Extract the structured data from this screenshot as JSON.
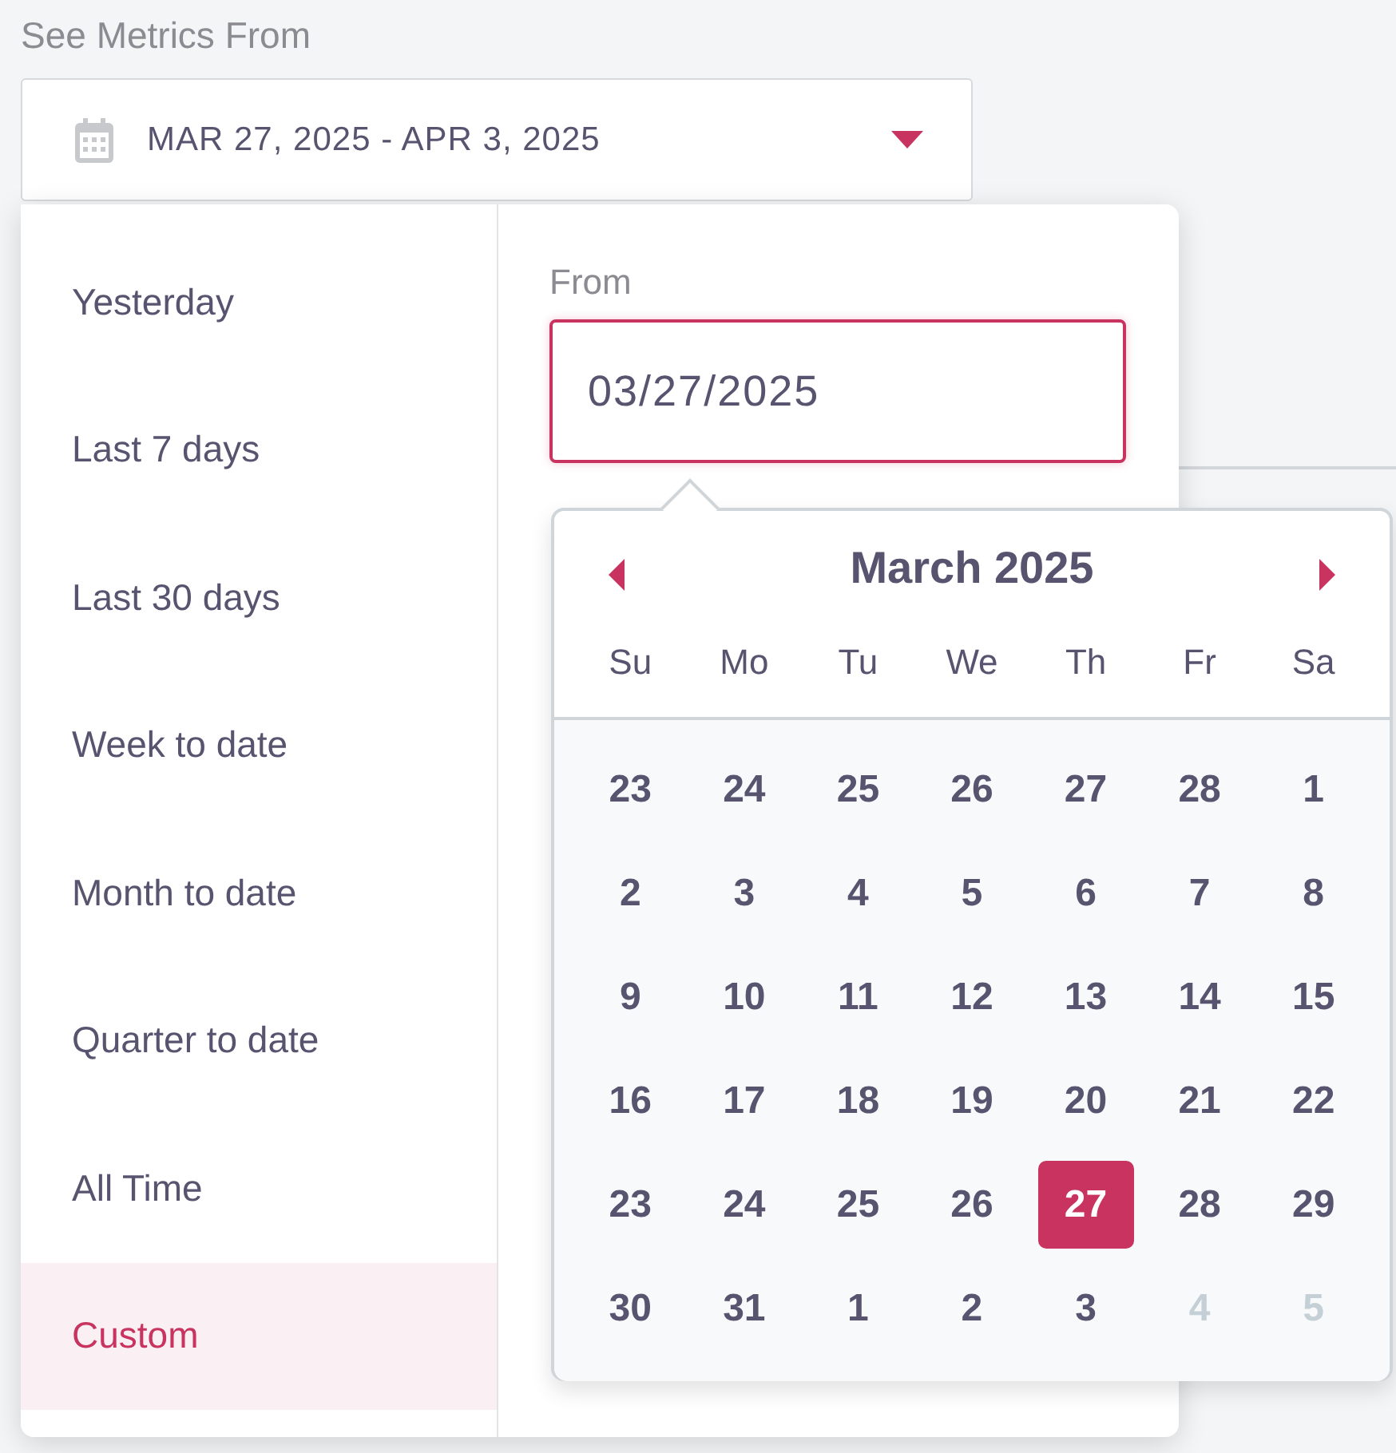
{
  "label": "See Metrics From",
  "range_picker": {
    "value": "MAR 27, 2025 - APR 3, 2025"
  },
  "presets": [
    {
      "label": "Yesterday",
      "selected": false
    },
    {
      "label": "Last 7 days",
      "selected": false
    },
    {
      "label": "Last 30 days",
      "selected": false
    },
    {
      "label": "Week to date",
      "selected": false
    },
    {
      "label": "Month to date",
      "selected": false
    },
    {
      "label": "Quarter to date",
      "selected": false
    },
    {
      "label": "All Time",
      "selected": false
    },
    {
      "label": "Custom",
      "selected": true
    }
  ],
  "from": {
    "label": "From",
    "value": "03/27/2025"
  },
  "calendar": {
    "title": "March 2025",
    "weekdays": [
      "Su",
      "Mo",
      "Tu",
      "We",
      "Th",
      "Fr",
      "Sa"
    ],
    "weeks": [
      [
        {
          "label": "23",
          "kind": "normal",
          "selected": false
        },
        {
          "label": "24",
          "kind": "normal",
          "selected": false
        },
        {
          "label": "25",
          "kind": "normal",
          "selected": false
        },
        {
          "label": "26",
          "kind": "normal",
          "selected": false
        },
        {
          "label": "27",
          "kind": "normal",
          "selected": false
        },
        {
          "label": "28",
          "kind": "normal",
          "selected": false
        },
        {
          "label": "1",
          "kind": "normal",
          "selected": false
        }
      ],
      [
        {
          "label": "2",
          "kind": "normal",
          "selected": false
        },
        {
          "label": "3",
          "kind": "normal",
          "selected": false
        },
        {
          "label": "4",
          "kind": "normal",
          "selected": false
        },
        {
          "label": "5",
          "kind": "normal",
          "selected": false
        },
        {
          "label": "6",
          "kind": "normal",
          "selected": false
        },
        {
          "label": "7",
          "kind": "normal",
          "selected": false
        },
        {
          "label": "8",
          "kind": "normal",
          "selected": false
        }
      ],
      [
        {
          "label": "9",
          "kind": "normal",
          "selected": false
        },
        {
          "label": "10",
          "kind": "normal",
          "selected": false
        },
        {
          "label": "11",
          "kind": "normal",
          "selected": false
        },
        {
          "label": "12",
          "kind": "normal",
          "selected": false
        },
        {
          "label": "13",
          "kind": "normal",
          "selected": false
        },
        {
          "label": "14",
          "kind": "normal",
          "selected": false
        },
        {
          "label": "15",
          "kind": "normal",
          "selected": false
        }
      ],
      [
        {
          "label": "16",
          "kind": "normal",
          "selected": false
        },
        {
          "label": "17",
          "kind": "normal",
          "selected": false
        },
        {
          "label": "18",
          "kind": "normal",
          "selected": false
        },
        {
          "label": "19",
          "kind": "normal",
          "selected": false
        },
        {
          "label": "20",
          "kind": "normal",
          "selected": false
        },
        {
          "label": "21",
          "kind": "normal",
          "selected": false
        },
        {
          "label": "22",
          "kind": "normal",
          "selected": false
        }
      ],
      [
        {
          "label": "23",
          "kind": "normal",
          "selected": false
        },
        {
          "label": "24",
          "kind": "normal",
          "selected": false
        },
        {
          "label": "25",
          "kind": "normal",
          "selected": false
        },
        {
          "label": "26",
          "kind": "normal",
          "selected": false
        },
        {
          "label": "27",
          "kind": "normal",
          "selected": true
        },
        {
          "label": "28",
          "kind": "normal",
          "selected": false
        },
        {
          "label": "29",
          "kind": "normal",
          "selected": false
        }
      ],
      [
        {
          "label": "30",
          "kind": "normal",
          "selected": false
        },
        {
          "label": "31",
          "kind": "normal",
          "selected": false
        },
        {
          "label": "1",
          "kind": "normal",
          "selected": false
        },
        {
          "label": "2",
          "kind": "normal",
          "selected": false
        },
        {
          "label": "3",
          "kind": "normal",
          "selected": false
        },
        {
          "label": "4",
          "kind": "muted",
          "selected": false
        },
        {
          "label": "5",
          "kind": "muted",
          "selected": false
        }
      ]
    ]
  }
}
